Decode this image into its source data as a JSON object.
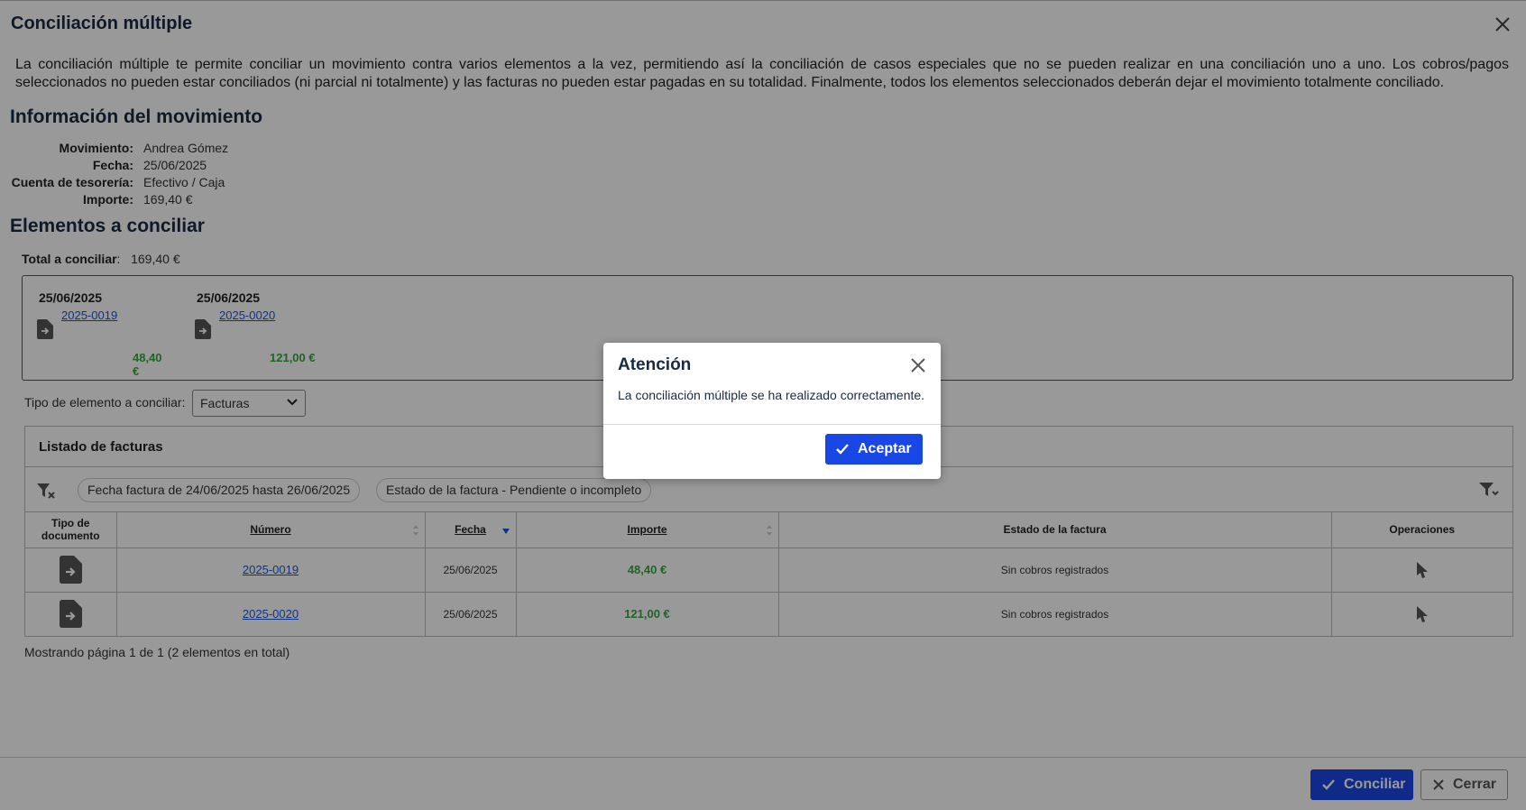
{
  "dialog": {
    "title": "Conciliación múltiple",
    "description": "La conciliación múltiple te permite conciliar un movimiento contra varios elementos a la vez, permitiendo así la conciliación de casos especiales que no se pueden realizar en una conciliación uno a uno. Los cobros/pagos seleccionados no pueden estar conciliados (ni parcial ni totalmente) y las facturas no pueden estar pagadas en su totalidad. Finalmente, todos los elementos seleccionados deberán dejar el movimiento totalmente conciliado."
  },
  "movement": {
    "heading": "Información del movimiento",
    "rows": [
      {
        "label": "Movimiento",
        "value": "Andrea Gómez"
      },
      {
        "label": "Fecha",
        "value": "25/06/2025"
      },
      {
        "label": "Cuenta de tesorería",
        "value": "Efectivo / Caja"
      },
      {
        "label": "Importe",
        "value": "169,40 €"
      }
    ]
  },
  "elements": {
    "heading": "Elementos a conciliar",
    "total_label": "Total a conciliar",
    "total_value": "169,40 €",
    "cards": [
      {
        "date": "25/06/2025",
        "number": "2025-0019",
        "amount": "48,40 €"
      },
      {
        "date": "25/06/2025",
        "number": "2025-0020",
        "amount": "121,00 €"
      }
    ],
    "type_label": "Tipo de elemento a conciliar:",
    "type_value": "Facturas"
  },
  "invoices": {
    "title": "Listado de facturas",
    "filters": [
      "Fecha factura de 24/06/2025 hasta 26/06/2025",
      "Estado de la factura - Pendiente o incompleto"
    ],
    "columns": [
      "Tipo de documento",
      "Número",
      "Fecha",
      "Importe",
      "Estado de la factura",
      "Operaciones"
    ],
    "rows": [
      {
        "number": "2025-0019",
        "date": "25/06/2025",
        "amount": "48,40 €",
        "status": "Sin cobros registrados"
      },
      {
        "number": "2025-0020",
        "date": "25/06/2025",
        "amount": "121,00 €",
        "status": "Sin cobros registrados"
      }
    ],
    "pager": "Mostrando página 1 de 1 (2 elementos en total)"
  },
  "footer": {
    "conciliar": "Conciliar",
    "cerrar": "Cerrar"
  },
  "alert": {
    "title": "Atención",
    "message": "La conciliación múltiple se ha realizado correctamente.",
    "accept": "Aceptar"
  },
  "colors": {
    "primary": "#1947e5",
    "amount_green": "#3aa541",
    "link_blue": "#1a56db",
    "heading": "#1a2a44"
  }
}
